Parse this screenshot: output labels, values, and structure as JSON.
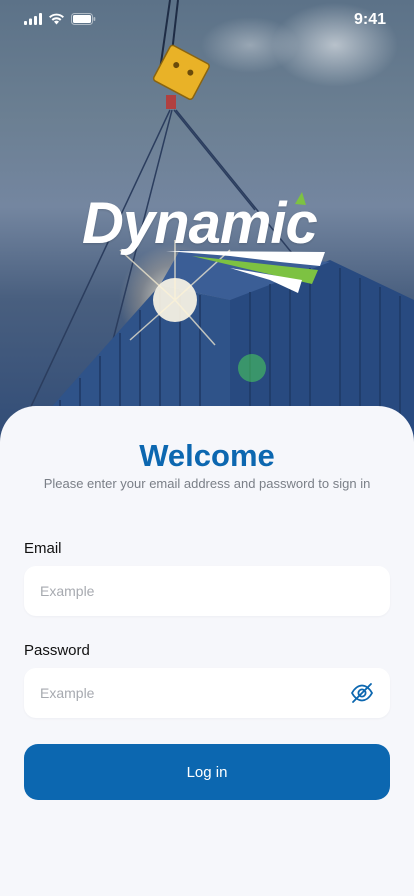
{
  "status_bar": {
    "time": "9:41",
    "icons": [
      "signal-icon",
      "wifi-icon",
      "battery-icon"
    ]
  },
  "brand": {
    "logo_text": "Dynamic",
    "colors": {
      "primary": "#0c67b0",
      "accent_green": "#7dc242",
      "background": "#f6f7fb"
    }
  },
  "login": {
    "title": "Welcome",
    "subtitle": "Please enter your email address and password to sign in",
    "email": {
      "label": "Email",
      "placeholder": "Example",
      "value": ""
    },
    "password": {
      "label": "Password",
      "placeholder": "Example",
      "value": "",
      "toggle_icon": "eye-off-icon"
    },
    "submit_label": "Log in"
  }
}
